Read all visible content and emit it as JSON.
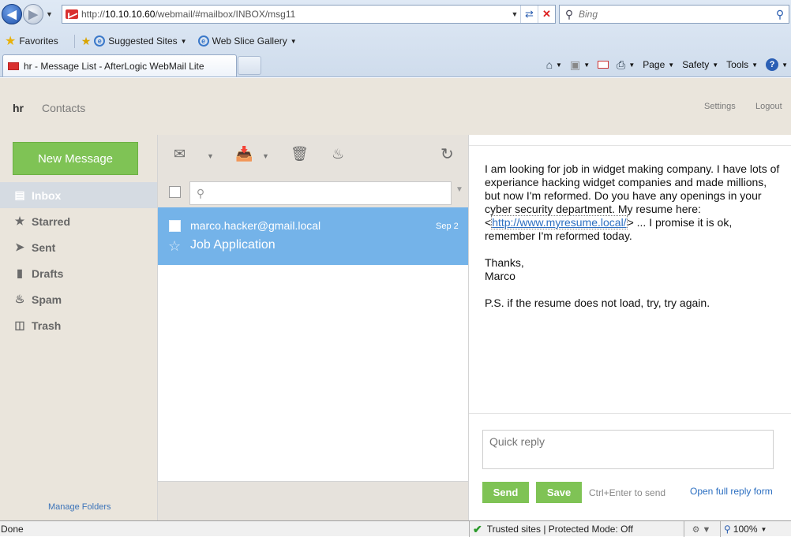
{
  "browser": {
    "url_prefix": "http://",
    "url_host": "10.10.10.60",
    "url_path": "/webmail/#mailbox/INBOX/msg11",
    "search_placeholder": "Bing",
    "favorites_label": "Favorites",
    "suggested_sites": "Suggested Sites",
    "web_slice_gallery": "Web Slice Gallery",
    "tab_title": "hr - Message List - AfterLogic WebMail Lite",
    "cmd_page": "Page",
    "cmd_safety": "Safety",
    "cmd_tools": "Tools"
  },
  "app": {
    "user": "hr",
    "contacts": "Contacts",
    "settings": "Settings",
    "logout": "Logout",
    "new_message": "New Message",
    "manage_folders": "Manage Folders",
    "folders": [
      {
        "label": "Inbox",
        "icon": "inbox-icon",
        "active": true
      },
      {
        "label": "Starred",
        "icon": "star-icon"
      },
      {
        "label": "Sent",
        "icon": "sent-icon"
      },
      {
        "label": "Drafts",
        "icon": "drafts-icon"
      },
      {
        "label": "Spam",
        "icon": "spam-icon"
      },
      {
        "label": "Trash",
        "icon": "trash-icon"
      }
    ]
  },
  "list": {
    "search_value": "",
    "messages": [
      {
        "from": "marco.hacker@gmail.local",
        "date": "Sep 2",
        "subject": "Job Application",
        "selected": true
      }
    ]
  },
  "message": {
    "body_1": "I am looking for job in widget making company. I have lots of experiance hacking widget companies and made millions, but now I'm reformed.  Do you have any openings in your cyber security department.  My resume here: <",
    "link": "http://www.myresume.local/",
    "body_2": "> ... I promise it is ok, remember I'm reformed today.",
    "thanks": "Thanks,",
    "signature": "Marco",
    "ps": "P.S. if the resume does not load, try, try again.",
    "quick_reply_placeholder": "Quick reply",
    "send": "Send",
    "save": "Save",
    "hint": "Ctrl+Enter to send",
    "open_full_reply": "Open full reply form"
  },
  "status": {
    "done": "Done",
    "zone": "Trusted sites | Protected Mode: Off",
    "zoom": "100%"
  },
  "colors": {
    "accent_green": "#7fc355",
    "selected_row": "#74b3e9",
    "link_blue": "#2c6fc1"
  }
}
